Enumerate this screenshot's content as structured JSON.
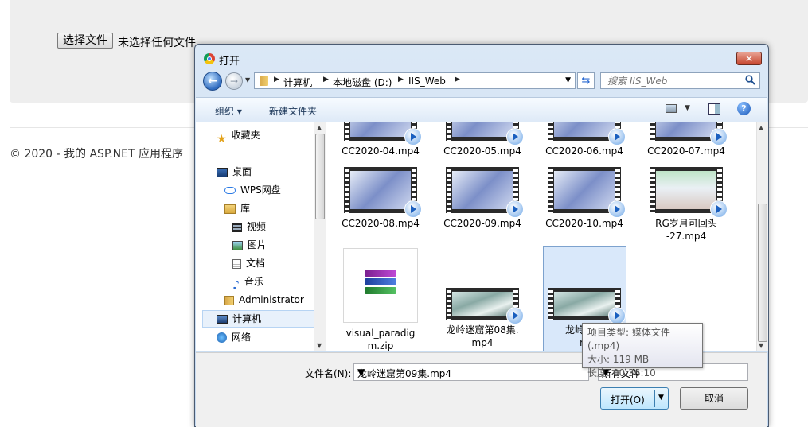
{
  "page": {
    "choose_file_label": "选择文件",
    "no_file_text": "未选择任何文件",
    "footer": "© 2020 - 我的 ASP.NET 应用程序"
  },
  "dialog": {
    "title": "打开",
    "breadcrumb": [
      "计算机",
      "本地磁盘 (D:)",
      "IIS_Web"
    ],
    "search_placeholder": "搜索 IIS_Web",
    "toolbar": {
      "organize": "组织 ▾",
      "new_folder": "新建文件夹"
    },
    "nav": [
      {
        "label": "收藏夹",
        "icon": "star-icon"
      },
      {
        "label": "桌面",
        "icon": "desktop-icon"
      },
      {
        "label": "WPS网盘",
        "icon": "cloud-icon"
      },
      {
        "label": "库",
        "icon": "library-icon"
      },
      {
        "label": "视频",
        "icon": "video-icon"
      },
      {
        "label": "图片",
        "icon": "picture-icon"
      },
      {
        "label": "文档",
        "icon": "document-icon"
      },
      {
        "label": "音乐",
        "icon": "music-icon"
      },
      {
        "label": "Administrator",
        "icon": "user-folder-icon"
      },
      {
        "label": "计算机",
        "icon": "computer-icon"
      },
      {
        "label": "网络",
        "icon": "network-icon"
      }
    ],
    "files": [
      {
        "name": "CC2020-04.mp4"
      },
      {
        "name": "CC2020-05.mp4"
      },
      {
        "name": "CC2020-06.mp4"
      },
      {
        "name": "CC2020-07.mp4"
      },
      {
        "name": "CC2020-08.mp4"
      },
      {
        "name": "CC2020-09.mp4"
      },
      {
        "name": "CC2020-10.mp4"
      },
      {
        "name_line1": "RG岁月可回头",
        "name_line2": "-27.mp4"
      },
      {
        "name_line1": "visual_paradig",
        "name_line2": "m.zip"
      },
      {
        "name_line1": "龙岭迷窟第08集.",
        "name_line2": "mp4"
      },
      {
        "name_line1": "龙岭迷窟",
        "name_line2": "m"
      }
    ],
    "tooltip": {
      "type": "项目类型: 媒体文件(.mp4)",
      "size": "大小: 119 MB",
      "length": "长度: 00:36:10"
    },
    "filename_label": "文件名(N):",
    "filename_value": "龙岭迷窟第09集.mp4",
    "filetype_value": "所有文件",
    "open_label": "打开(O)",
    "cancel_label": "取消"
  }
}
